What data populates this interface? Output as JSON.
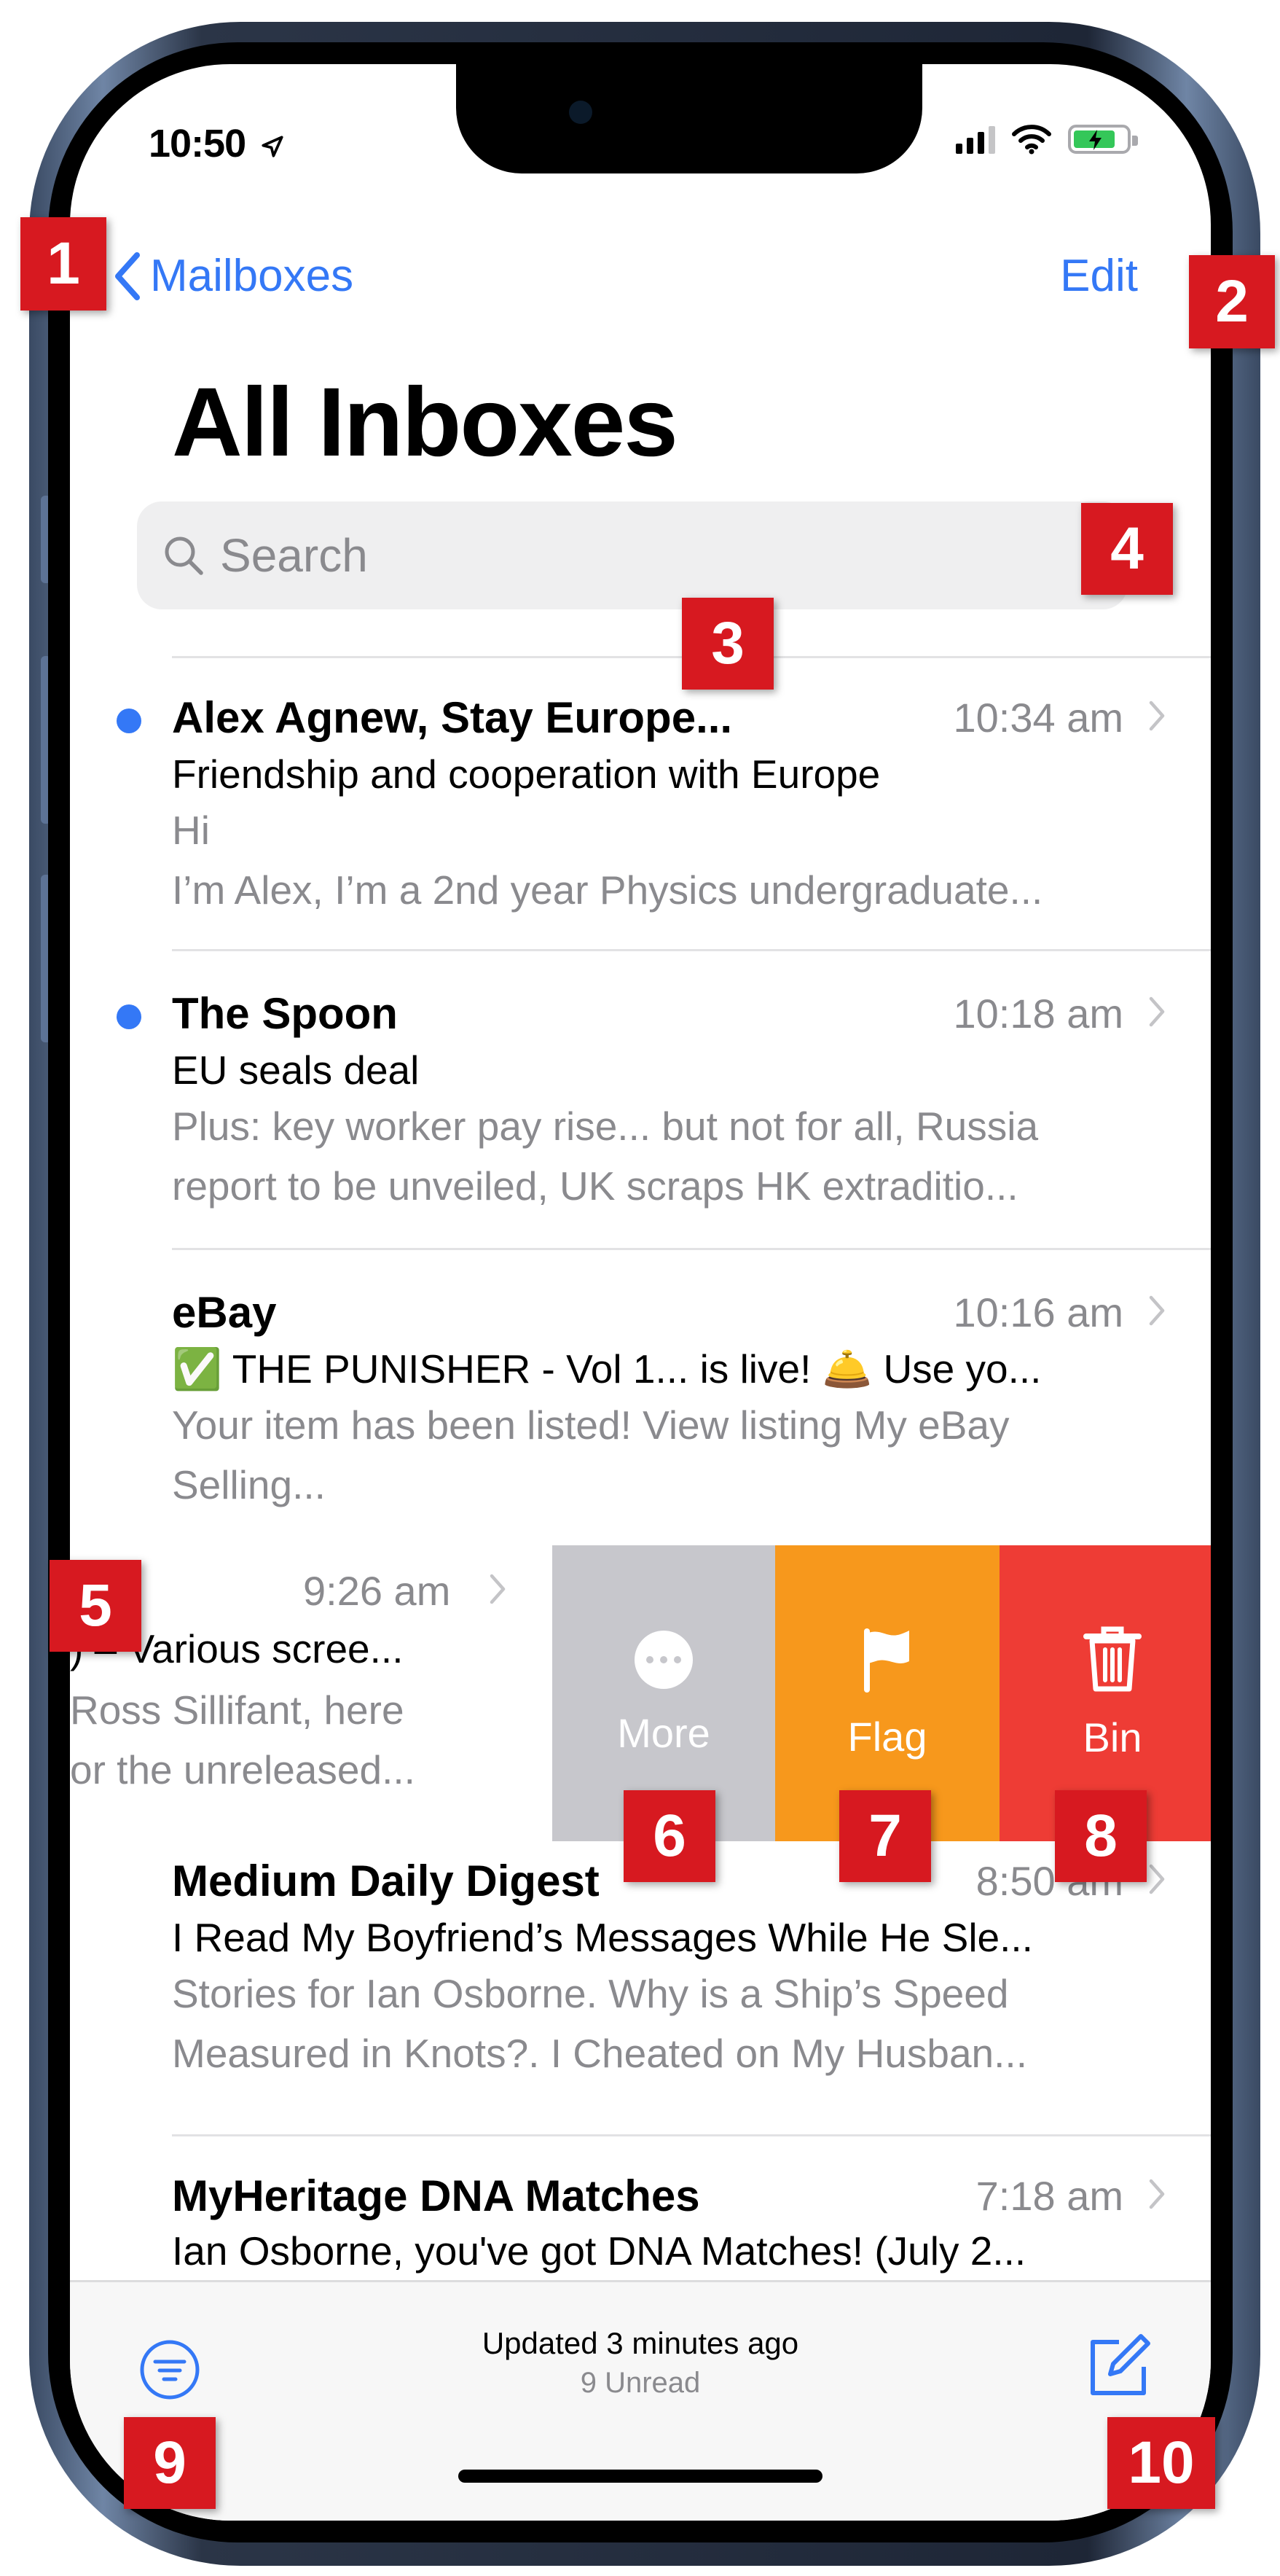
{
  "status_bar": {
    "time": "10:50"
  },
  "nav": {
    "back_label": "Mailboxes",
    "edit_label": "Edit",
    "title": "All Inboxes"
  },
  "search": {
    "placeholder": "Search"
  },
  "messages": [
    {
      "sender": "Alex Agnew, Stay Europe...",
      "time": "10:34 am",
      "subject": "Friendship and cooperation with Europe",
      "preview_1": "Hi",
      "preview_2": "I’m Alex, I’m a 2nd year Physics undergraduate...",
      "unread": true
    },
    {
      "sender": "The Spoon",
      "time": "10:18 am",
      "subject": "EU seals deal",
      "preview_1": "Plus: key worker pay rise... but not for all, Russia",
      "preview_2": "report to be unveiled, UK scraps HK extraditio...",
      "unread": true
    },
    {
      "sender": "eBay",
      "time": "10:16 am",
      "subject": "✅ THE PUNISHER - Vol 1... is live! 🛎️ Use yo...",
      "preview_1": "Your item has been listed! View listing My eBay",
      "preview_2": "Selling...",
      "unread": false
    },
    {
      "sender": "Medium Daily Digest",
      "time": "8:50 am",
      "subject": "I Read My Boyfriend’s Messages While He Sle...",
      "preview_1": "Stories for Ian Osborne. Why is a Ship’s Speed",
      "preview_2": "Measured in Knots?. I Cheated on My Husban...",
      "unread": false
    },
    {
      "sender": "MyHeritage DNA Matches",
      "time": "7:18 am",
      "subject": "Ian Osborne, you've got DNA Matches! (July 2...",
      "unread": false
    }
  ],
  "swiped_message": {
    "time": "9:26 am",
    "subject": ") – Various scree...",
    "preview_1": "Ross Sillifant, here",
    "preview_2": "or the unreleased...",
    "actions": {
      "more": "More",
      "flag": "Flag",
      "bin": "Bin"
    }
  },
  "toolbar": {
    "updated": "Updated 3 minutes ago",
    "unread_count": "9 Unread"
  },
  "callouts": [
    "1",
    "2",
    "3",
    "4",
    "5",
    "6",
    "7",
    "8",
    "9",
    "10"
  ],
  "colors": {
    "accent": "#3478f6",
    "unread_dot": "#3478f6",
    "more": "#c7c7cc",
    "flag": "#f7981c",
    "bin": "#ee3c35",
    "callout": "#d71920"
  }
}
